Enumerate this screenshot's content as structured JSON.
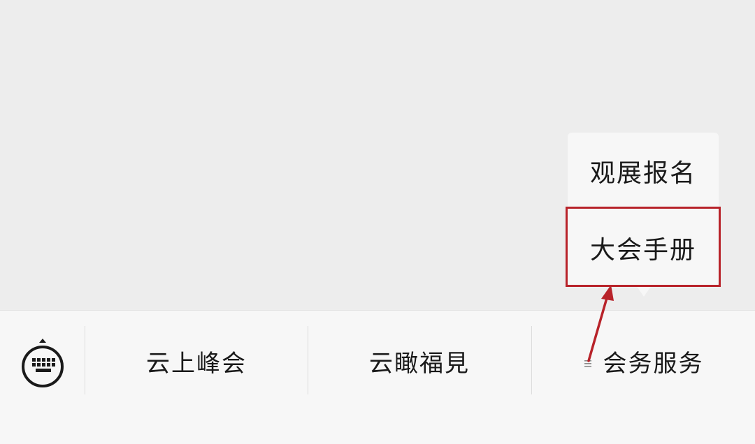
{
  "submenu": {
    "items": [
      {
        "label": "观展报名"
      },
      {
        "label": "大会手册"
      }
    ]
  },
  "menu_bar": {
    "tabs": [
      {
        "label": "云上峰会"
      },
      {
        "label": "云瞰福見"
      },
      {
        "label": "会务服务"
      }
    ]
  },
  "colors": {
    "highlight": "#b8232a",
    "background": "#ededed",
    "menu_background": "#f7f7f7"
  }
}
